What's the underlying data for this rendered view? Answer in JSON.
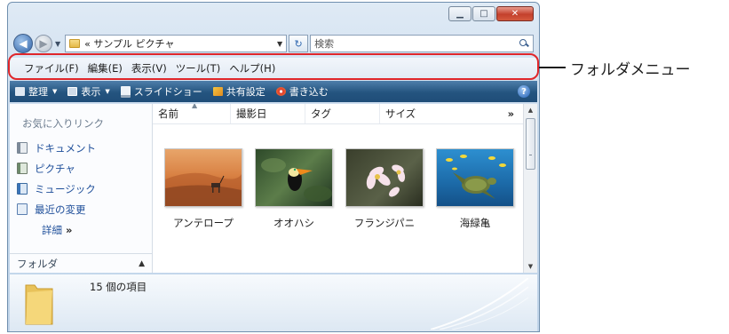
{
  "address": {
    "path": "« サンプル ピクチャ"
  },
  "search": {
    "placeholder": "検索"
  },
  "menu": [
    "ファイル(F)",
    "編集(E)",
    "表示(V)",
    "ツール(T)",
    "ヘルプ(H)"
  ],
  "toolbar": {
    "organize": "整理",
    "views": "表示",
    "slideshow": "スライドショー",
    "share": "共有設定",
    "burn": "書き込む"
  },
  "nav": {
    "favorites_title": "お気に入りリンク",
    "items": [
      "ドキュメント",
      "ピクチャ",
      "ミュージック",
      "最近の変更"
    ],
    "more": "詳細",
    "more_arrow": "»",
    "folders": "フォルダ"
  },
  "columns": {
    "name": "名前",
    "date_taken": "撮影日",
    "tags": "タグ",
    "size": "サイズ",
    "more": "»"
  },
  "files": [
    {
      "label": "アンテロープ",
      "icon": "antelope-photo"
    },
    {
      "label": "オオハシ",
      "icon": "toucan-photo"
    },
    {
      "label": "フランジパニ",
      "icon": "frangipani-photo"
    },
    {
      "label": "海緑亀",
      "icon": "sea-turtle-photo"
    }
  ],
  "details": {
    "item_count": "15 個の項目"
  },
  "callout": {
    "label": "フォルダメニュー"
  },
  "colors": {
    "highlight": "#e0262a",
    "toolbar": "#24547f",
    "link": "#1f4f9a"
  }
}
